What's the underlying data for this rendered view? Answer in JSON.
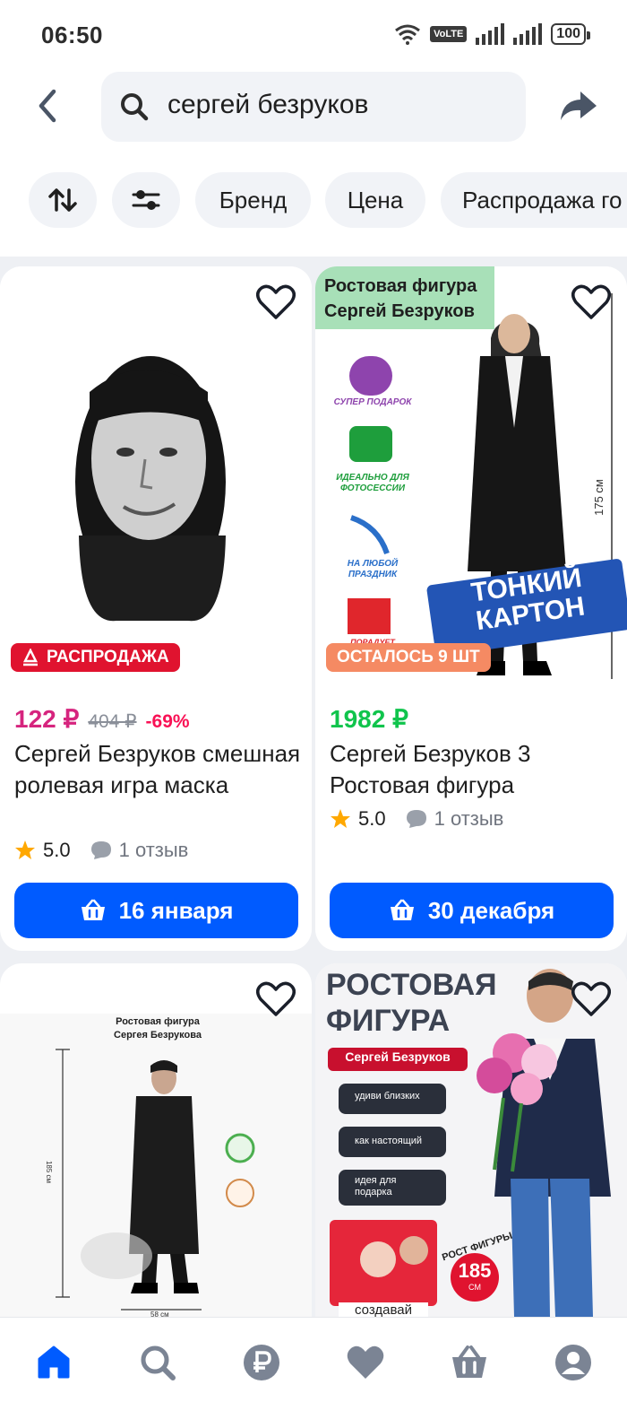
{
  "status": {
    "time": "06:50",
    "network": "VoLTE",
    "battery": "100"
  },
  "search": {
    "query": "сергей безруков"
  },
  "filters": {
    "chips": [
      "Бренд",
      "Цена",
      "Распродажа го"
    ]
  },
  "products": [
    {
      "badge": "РАСПРОДАЖА",
      "price": "122 ₽",
      "old_price": "404 ₽",
      "discount": "-69%",
      "title": "Сергей Безруков смешная ролевая игра маска",
      "rating": "5.0",
      "reviews": "1 отзыв",
      "delivery": "16 января"
    },
    {
      "img_title": "Ростовая фигура Сергей Безруков",
      "perks": [
        "СУПЕР ПОДАРОК",
        "ИДЕАЛЬНО ДЛЯ ФОТОСЕССИИ",
        "НА ЛЮБОЙ ПРАЗДНИК",
        "ПОРАДУЕТ"
      ],
      "size_label": "175 см",
      "sticker": "ТОНКИЙ КАРТОН",
      "badge": "ОСТАЛОСЬ 9 ШТ",
      "price": "1982 ₽",
      "title": "Сергей Безруков 3 Ростовая фигура",
      "rating": "5.0",
      "reviews": "1 отзыв",
      "delivery": "30 декабря"
    },
    {
      "img_title": "Ростовая фигура Сергея Безрукова",
      "size_label": "185 см",
      "bottom_label": "58 см"
    },
    {
      "img_title": "РОСТОВАЯ ФИГУРА",
      "img_name": "Сергей Безруков",
      "perks": [
        "удиви близких",
        "как настоящий",
        "идея для подарка"
      ],
      "height_caption": "РОСТ ФИГУРЫ",
      "height_value": "185",
      "height_unit": "СМ",
      "caption": "создавай"
    }
  ],
  "colors": {
    "accent": "#005bff",
    "sale_price": "#d6247e",
    "green_price": "#10c44c",
    "sale_badge": "#e0132f",
    "stock_badge": "#f58a63"
  }
}
